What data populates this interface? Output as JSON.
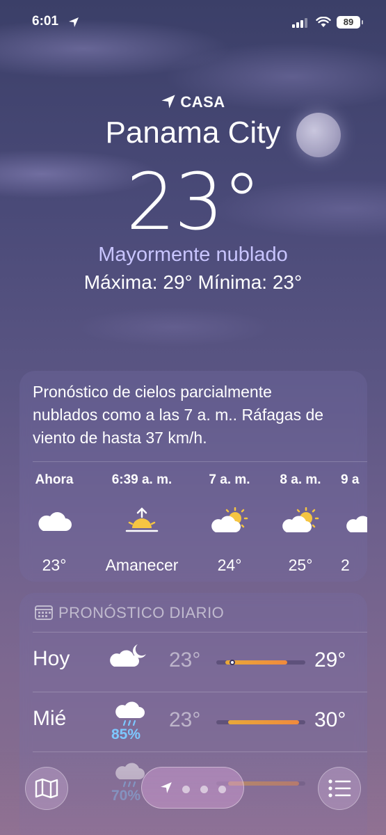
{
  "status_bar": {
    "time": "6:01",
    "battery": "89"
  },
  "location": {
    "label": "CASA",
    "city": "Panama City"
  },
  "current": {
    "temperature": "23°",
    "condition": "Mayormente nublado",
    "high_low": "Máxima: 29°  Mínima: 23°"
  },
  "hourly": {
    "summary": "Pronóstico de cielos parcialmente nublados como a las 7 a. m.. Ráfagas de viento de hasta 37 km/h.",
    "items": [
      {
        "time": "Ahora",
        "icon": "cloud-icon",
        "value": "23°"
      },
      {
        "time": "6:39 a. m.",
        "icon": "sunrise-icon",
        "value": "Amanecer"
      },
      {
        "time": "7 a. m.",
        "icon": "partly-sunny-icon",
        "value": "24°"
      },
      {
        "time": "8 a. m.",
        "icon": "partly-sunny-icon",
        "value": "25°"
      },
      {
        "time": "9 a",
        "icon": "partly-sunny-icon",
        "value": "2"
      }
    ]
  },
  "daily": {
    "header": "PRONÓSTICO DIARIO",
    "days": [
      {
        "name": "Hoy",
        "icon": "cloud-moon-icon",
        "precip": "",
        "low": "23°",
        "high": "29°",
        "range_start": 0.1,
        "range_end": 0.8,
        "current": 0.18
      },
      {
        "name": "Mié",
        "icon": "cloud-rain-icon",
        "precip": "85%",
        "low": "23°",
        "high": "30°",
        "range_start": 0.13,
        "range_end": 0.93
      },
      {
        "name": "",
        "icon": "cloud-rain-icon",
        "precip": "70%",
        "low": "",
        "high": "",
        "range_start": 0.13,
        "range_end": 0.93
      }
    ]
  },
  "colors": {
    "accent_condition": "#c9c5ff",
    "precip": "#7dc8ff",
    "bar_fill": "#f08a3c"
  }
}
